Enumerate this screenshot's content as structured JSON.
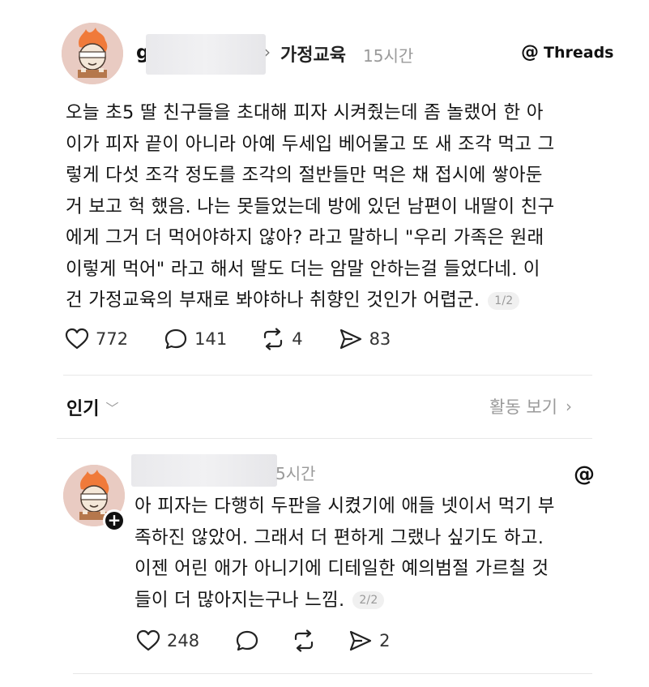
{
  "post": {
    "username_visible": "g",
    "topic": "가정교육",
    "time": "15시간",
    "brand": "Threads",
    "lines": [
      "오늘 초5 딸 친구들을 초대해 피자 시켜줬는데 좀 놀랬어 한 아",
      "이가 피자 끝이 아니라 아예 두세입 베어물고 또 새 조각 먹고 그",
      "렇게 다섯 조각 정도를 조각의 절반들만 먹은 채 접시에 쌓아둔",
      "거 보고 헉 했음. 나는 못들었는데 방에 있던 남편이 내딸이 친구",
      "에게 그거 더 먹어야하지 않아? 라고 말하니 \"우리 가족은 원래",
      "이렇게 먹어\" 라고 해서 딸도 더는 암말 안하는걸 들었다네. 이",
      "건 가정교육의 부재로 봐야하나 취향인 것인가 어렵군."
    ],
    "page_indicator": "1/2",
    "likes": "772",
    "comments": "141",
    "reposts": "4",
    "shares": "83"
  },
  "section": {
    "popular_label": "인기",
    "activity_label": "활동 보기"
  },
  "reply": {
    "time": "5시간",
    "lines": [
      "아 피자는 다행히 두판을 시켰기에 애들 넷이서 먹기 부",
      "족하진 않았어. 그래서 더 편하게 그랬나 싶기도 하고.",
      "이젠 어린 애가 아니기에 디테일한 예의범절 가르칠 것",
      "들이 더 많아지는구나 느낌."
    ],
    "page_indicator": "2/2",
    "likes": "248",
    "shares": "2"
  }
}
